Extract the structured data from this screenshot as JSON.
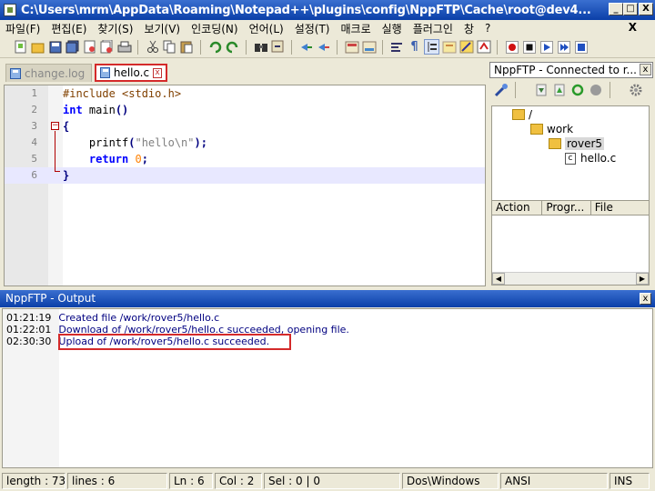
{
  "window": {
    "title": "C:\\Users\\mrm\\AppData\\Roaming\\Notepad++\\plugins\\config\\NppFTP\\Cache\\root@dev4...",
    "min": "_",
    "max": "□",
    "close": "X"
  },
  "menu": [
    "파일(F)",
    "편집(E)",
    "찾기(S)",
    "보기(V)",
    "인코딩(N)",
    "언어(L)",
    "설정(T)",
    "매크로",
    "실행",
    "플러그인",
    "창",
    "?"
  ],
  "menu_close": "X",
  "toolbar_icons": [
    "new-file-icon",
    "open-file-icon",
    "save-icon",
    "save-all-icon",
    "close-file-icon",
    "close-all-icon",
    "print-icon",
    "cut-icon",
    "copy-icon",
    "paste-icon",
    "undo-icon",
    "redo-icon",
    "find-icon",
    "replace-icon",
    "zoom-in-icon",
    "zoom-out-icon",
    "sync-v-icon",
    "sync-h-icon",
    "word-wrap-icon",
    "show-all-chars-icon",
    "indent-guide-icon",
    "fold-icon",
    "doc-map-icon",
    "function-list-icon",
    "record-macro-icon",
    "stop-macro-icon",
    "play-macro-icon",
    "run-macro-icon",
    "save-macro-icon"
  ],
  "tabs": [
    {
      "label": "change.log",
      "active": false
    },
    {
      "label": "hello.c",
      "active": true,
      "close": "x"
    }
  ],
  "editor": {
    "lines": [
      {
        "n": "1",
        "parts": [
          {
            "c": "pp",
            "t": "#include <stdio.h>"
          }
        ]
      },
      {
        "n": "2",
        "parts": [
          {
            "c": "kw",
            "t": "int"
          },
          {
            "c": "",
            "t": " main"
          },
          {
            "c": "op",
            "t": "()"
          }
        ]
      },
      {
        "n": "3",
        "parts": [
          {
            "c": "op",
            "t": "{"
          }
        ]
      },
      {
        "n": "4",
        "parts": [
          {
            "c": "",
            "t": "    printf"
          },
          {
            "c": "op",
            "t": "("
          },
          {
            "c": "str",
            "t": "\"hello\\n\""
          },
          {
            "c": "op",
            "t": ");"
          }
        ]
      },
      {
        "n": "5",
        "parts": [
          {
            "c": "",
            "t": "    "
          },
          {
            "c": "kw",
            "t": "return"
          },
          {
            "c": "",
            "t": " "
          },
          {
            "c": "num",
            "t": "0"
          },
          {
            "c": "op",
            "t": ";"
          }
        ]
      },
      {
        "n": "6",
        "parts": [
          {
            "c": "op",
            "t": "}"
          }
        ]
      }
    ],
    "current_line": 6
  },
  "ftp": {
    "title": "NppFTP - Connected to r...",
    "close": "x",
    "tree": [
      {
        "label": "/",
        "type": "folder",
        "depth": 0
      },
      {
        "label": "work",
        "type": "folder",
        "depth": 1
      },
      {
        "label": "rover5",
        "type": "folder",
        "depth": 2,
        "selected": true
      },
      {
        "label": "hello.c",
        "type": "file",
        "depth": 3,
        "icon_text": "c"
      }
    ],
    "queue_columns": [
      "Action",
      "Progr...",
      "File"
    ]
  },
  "output": {
    "title": "NppFTP - Output",
    "close": "x",
    "lines": [
      {
        "time": "01:21:19",
        "msg": "Created file /work/rover5/hello.c"
      },
      {
        "time": "01:22:01",
        "msg": "Download of /work/rover5/hello.c succeeded, opening file."
      },
      {
        "time": "02:30:30",
        "msg": "Upload of /work/rover5/hello.c succeeded."
      }
    ]
  },
  "status": {
    "length": "length : 73",
    "lines": "lines : 6",
    "ln": "Ln : 6",
    "col": "Col : 2",
    "sel": "Sel : 0 | 0",
    "eol": "Dos\\Windows",
    "encoding": "ANSI",
    "mode": "INS"
  }
}
